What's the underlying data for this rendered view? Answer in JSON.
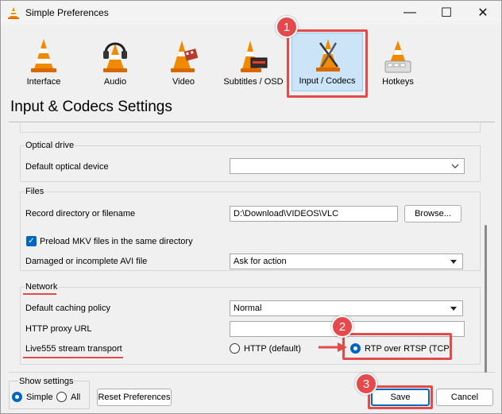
{
  "window": {
    "title": "Simple Preferences",
    "controls": {
      "minimize": "—",
      "maximize": "☐",
      "close": "✕"
    }
  },
  "categories": [
    {
      "id": "interface",
      "label": "Interface",
      "icon": "cone-icon"
    },
    {
      "id": "audio",
      "label": "Audio",
      "icon": "cone-headphones-icon"
    },
    {
      "id": "video",
      "label": "Video",
      "icon": "cone-film-icon"
    },
    {
      "id": "subtitles",
      "label": "Subtitles / OSD",
      "icon": "cone-subtitles-icon"
    },
    {
      "id": "input",
      "label": "Input / Codecs",
      "icon": "cone-codecs-icon",
      "selected": true
    },
    {
      "id": "hotkeys",
      "label": "Hotkeys",
      "icon": "cone-keys-icon"
    }
  ],
  "settings_title": "Input & Codecs Settings",
  "optical": {
    "title": "Optical drive",
    "device_label": "Default optical device",
    "device_value": ""
  },
  "files": {
    "title": "Files",
    "record_label": "Record directory or filename",
    "record_value": "D:\\Download\\VIDEOS\\VLC",
    "browse_label": "Browse...",
    "preload_label": "Preload MKV files in the same directory",
    "avi_label": "Damaged or incomplete AVI file",
    "avi_value": "Ask for action"
  },
  "network": {
    "title": "Network",
    "caching_label": "Default caching policy",
    "caching_value": "Normal",
    "proxy_label": "HTTP proxy URL",
    "proxy_value": "",
    "transport_label": "Live555 stream transport",
    "option_http": "HTTP (default)",
    "option_rtsp": "RTP over RTSP (TCP)"
  },
  "show_settings": {
    "title": "Show settings",
    "simple": "Simple",
    "all": "All"
  },
  "buttons": {
    "reset": "Reset Preferences",
    "save": "Save",
    "cancel": "Cancel"
  },
  "annotations": {
    "step1": "1",
    "step2": "2",
    "step3": "3"
  },
  "colors": {
    "highlight": "#e34b4b",
    "accent": "#0067c0",
    "selected_bg": "#cce4f7"
  }
}
